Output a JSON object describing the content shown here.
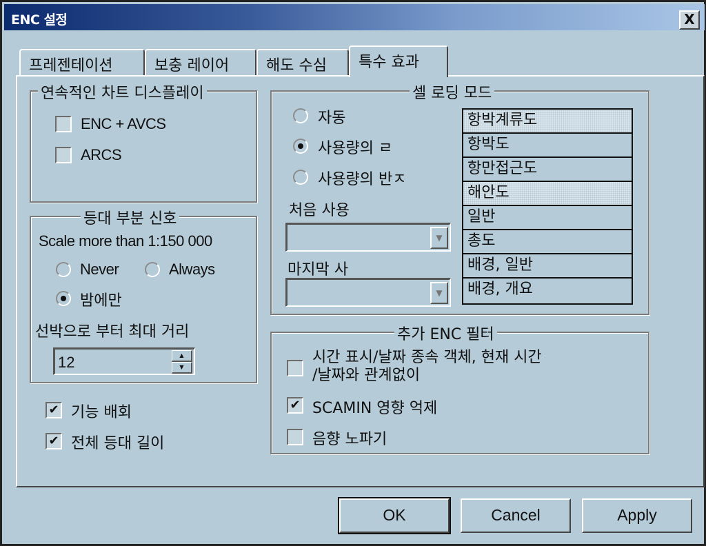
{
  "window": {
    "title": "ENC 설정",
    "close_label": "X"
  },
  "tabs": [
    {
      "label": "프레젠테이션",
      "active": false
    },
    {
      "label": "보충 레이어",
      "active": false
    },
    {
      "label": "해도 수심",
      "active": false
    },
    {
      "label": "특수 효과",
      "active": true
    }
  ],
  "continuous_display": {
    "title": "연속적인 차트 디스플레이",
    "options": [
      {
        "label": "ENC + AVCS",
        "checked": false
      },
      {
        "label": "ARCS",
        "checked": false
      }
    ]
  },
  "light_sector": {
    "title": "등대 부분 신호",
    "scale_label": "Scale more than 1:150 000",
    "radios": [
      {
        "label": "Never",
        "selected": false
      },
      {
        "label": "Always",
        "selected": false
      },
      {
        "label": "밤에만",
        "selected": true
      }
    ],
    "distance_label": "선박으로 부터 최대 거리",
    "distance_value": "12"
  },
  "bottom_checks": [
    {
      "label": "기능 배회",
      "checked": true
    },
    {
      "label": "전체 등대 길이",
      "checked": true
    }
  ],
  "cell_loading": {
    "title": "셀 로딩 모드",
    "radios": [
      {
        "label": "자동",
        "selected": false
      },
      {
        "label": "사용량의 ㄹ",
        "selected": true
      },
      {
        "label": "사용량의 반ㅈ",
        "selected": false
      }
    ],
    "first_use_label": "처음 사용",
    "first_use_value": "",
    "last_use_label": "마지막 사",
    "last_use_value": "",
    "chart_types": [
      {
        "label": "항박계류도",
        "highlighted": true
      },
      {
        "label": "항박도",
        "highlighted": false
      },
      {
        "label": "항만접근도",
        "highlighted": false
      },
      {
        "label": "해안도",
        "highlighted": true
      },
      {
        "label": "일반",
        "highlighted": false
      },
      {
        "label": "총도",
        "highlighted": false
      },
      {
        "label": "배경, 일반",
        "highlighted": false
      },
      {
        "label": "배경, 개요",
        "highlighted": false
      }
    ]
  },
  "enc_filter": {
    "title": "추가 ENC 필터",
    "options": [
      {
        "label_line1": "시간 표시/날짜 종속 객체, 현재 시간",
        "label_line2": "/날짜와 관계없이",
        "checked": false
      },
      {
        "label": "SCAMIN 영향 억제",
        "checked": true
      },
      {
        "label": "음향  노파기",
        "checked": false
      }
    ]
  },
  "buttons": {
    "ok": "OK",
    "cancel": "Cancel",
    "apply": "Apply"
  },
  "icons": {
    "check": "✔",
    "close": "close-icon",
    "arrow_down": "▼",
    "arrow_up": "▲"
  }
}
